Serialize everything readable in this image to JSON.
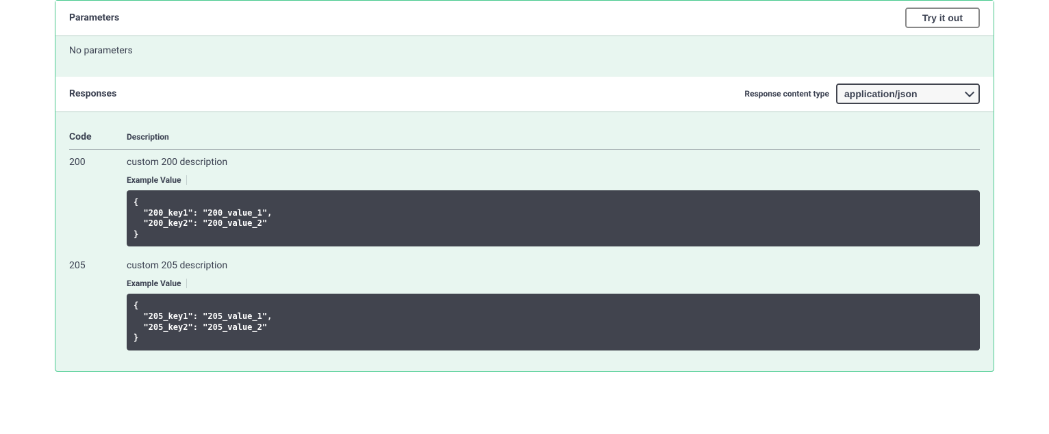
{
  "parameters": {
    "heading": "Parameters",
    "try_it_out_label": "Try it out",
    "empty_text": "No parameters"
  },
  "responses": {
    "heading": "Responses",
    "content_type_label": "Response content type",
    "content_type_value": "application/json",
    "columns": {
      "code": "Code",
      "description": "Description"
    },
    "example_value_label": "Example Value",
    "items": [
      {
        "code": "200",
        "description": "custom 200 description",
        "example": "{\n  \"200_key1\": \"200_value_1\",\n  \"200_key2\": \"200_value_2\"\n}"
      },
      {
        "code": "205",
        "description": "custom 205 description",
        "example": "{\n  \"205_key1\": \"205_value_1\",\n  \"205_key2\": \"205_value_2\"\n}"
      }
    ]
  }
}
